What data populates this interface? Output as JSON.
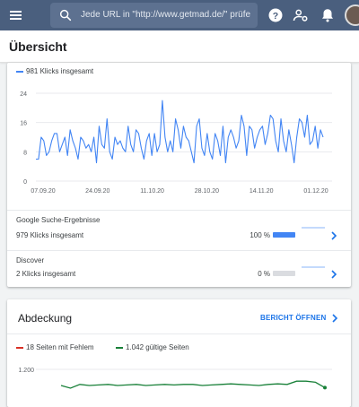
{
  "topbar": {
    "menu_icon": "menu-icon",
    "search_placeholder": "Jede URL in \"http://www.getmad.de/\" prüfe",
    "help_icon": "help-icon",
    "manage_users_icon": "manage-accounts-icon",
    "notifications_icon": "notifications-icon",
    "avatar": "user-avatar"
  },
  "page": {
    "title": "Übersicht"
  },
  "performance": {
    "legend_label": "981 Klicks insgesamt",
    "legend_color": "#4285f4",
    "rows": [
      {
        "title": "Google Suche-Ergebnisse",
        "subtitle": "979 Klicks insgesamt",
        "percent_label": "100 %",
        "fill_fraction": 1.0
      },
      {
        "title": "Discover",
        "subtitle": "2 Klicks insgesamt",
        "percent_label": "0 %",
        "fill_fraction": 0.0
      }
    ]
  },
  "coverage": {
    "title": "Abdeckung",
    "report_link": "BERICHT ÖFFNEN",
    "legend": [
      {
        "label": "18 Seiten mit Fehlem",
        "color": "#d93025"
      },
      {
        "label": "1.042 gültige Seiten",
        "color": "#188038"
      }
    ],
    "y_tick": "1.200"
  },
  "chart_data": [
    {
      "type": "line",
      "series": [
        {
          "name": "981 Klicks insgesamt",
          "color": "#4285f4",
          "values": [
            6,
            6,
            12,
            11,
            7,
            8,
            11,
            13,
            13,
            8,
            10,
            12,
            7,
            14,
            11,
            9,
            6,
            12,
            11,
            9,
            10,
            8,
            12,
            5,
            15,
            10,
            9,
            17,
            8,
            6,
            12,
            10,
            11,
            9,
            8,
            15,
            10,
            8,
            14,
            13,
            9,
            6,
            11,
            13,
            7,
            13,
            8,
            10,
            22,
            12,
            8,
            11,
            8,
            17,
            14,
            9,
            15,
            12,
            11,
            8,
            5,
            15,
            17,
            9,
            7,
            13,
            8,
            6,
            13,
            11,
            7,
            15,
            5,
            12,
            14,
            12,
            9,
            11,
            18,
            15,
            7,
            15,
            14,
            9,
            12,
            14,
            15,
            10,
            13,
            18,
            17,
            11,
            8,
            17,
            11,
            8,
            14,
            10,
            5,
            12,
            17,
            16,
            12,
            18,
            10,
            11,
            15,
            9,
            14,
            12
          ]
        }
      ],
      "x_tick_labels": [
        "07.09.20",
        "24.09.20",
        "11.10.20",
        "28.10.20",
        "14.11.20",
        "01.12.20"
      ],
      "y_ticks": [
        0,
        8,
        16,
        24
      ],
      "ylim": [
        0,
        24
      ],
      "grid": true
    },
    {
      "type": "line",
      "series": [
        {
          "name": "1.042 gültige Seiten",
          "color": "#188038",
          "values": [
            1170,
            1165,
            1172,
            1170,
            1171,
            1172,
            1170,
            1171,
            1172,
            1170,
            1171,
            1172,
            1171,
            1172,
            1172,
            1170,
            1171,
            1172,
            1173,
            1172,
            1171,
            1170,
            1172,
            1173,
            1172,
            1178,
            1178,
            1176,
            1166
          ]
        }
      ],
      "y_ticks": [
        1200
      ],
      "grid": true
    }
  ]
}
